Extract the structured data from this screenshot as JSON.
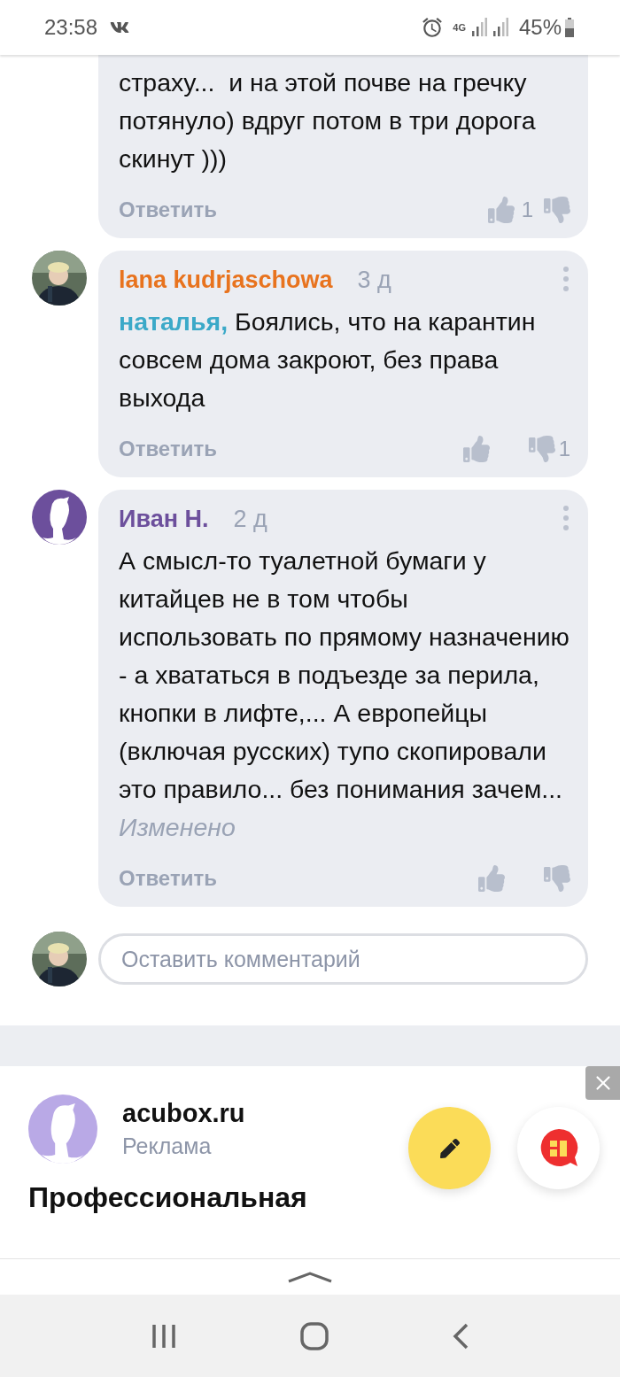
{
  "status_bar": {
    "time": "23:58",
    "network": "4G",
    "battery": "45%"
  },
  "comments": [
    {
      "text": "страху...  и на этой почве на гречку потянуло) вдруг потом в три дорога скинут )))",
      "reply_label": "Ответить",
      "likes": "1"
    },
    {
      "author": "lana kudrjaschowa",
      "color": "#e8731e",
      "time": "3 д",
      "mention": "наталья,",
      "text": "Боялись, что на карантин совсем дома закроют, без права выхода",
      "reply_label": "Ответить",
      "dislikes": "1",
      "menu": true
    },
    {
      "avatar": {
        "kind": "silhouette"
      },
      "author": "Иван Н.",
      "color": "#6c4f9c",
      "time": "2 д",
      "text": "А смысл-то туалетной бумаги у китайцев не в том чтобы использовать по прямому назначению - а хвататься в подъезде за перила, кнопки в лифте,... А европейцы (включая русских) тупо скопировали это правило... без понимания зачем...  *Изменено*",
      "reply_label": "Ответить",
      "menu": true
    }
  ],
  "comment_input": {
    "placeholder": "Оставить комментарий"
  },
  "ad": {
    "site": "acubox.ru",
    "label": "Реклама",
    "headline": "Профессиональная"
  }
}
